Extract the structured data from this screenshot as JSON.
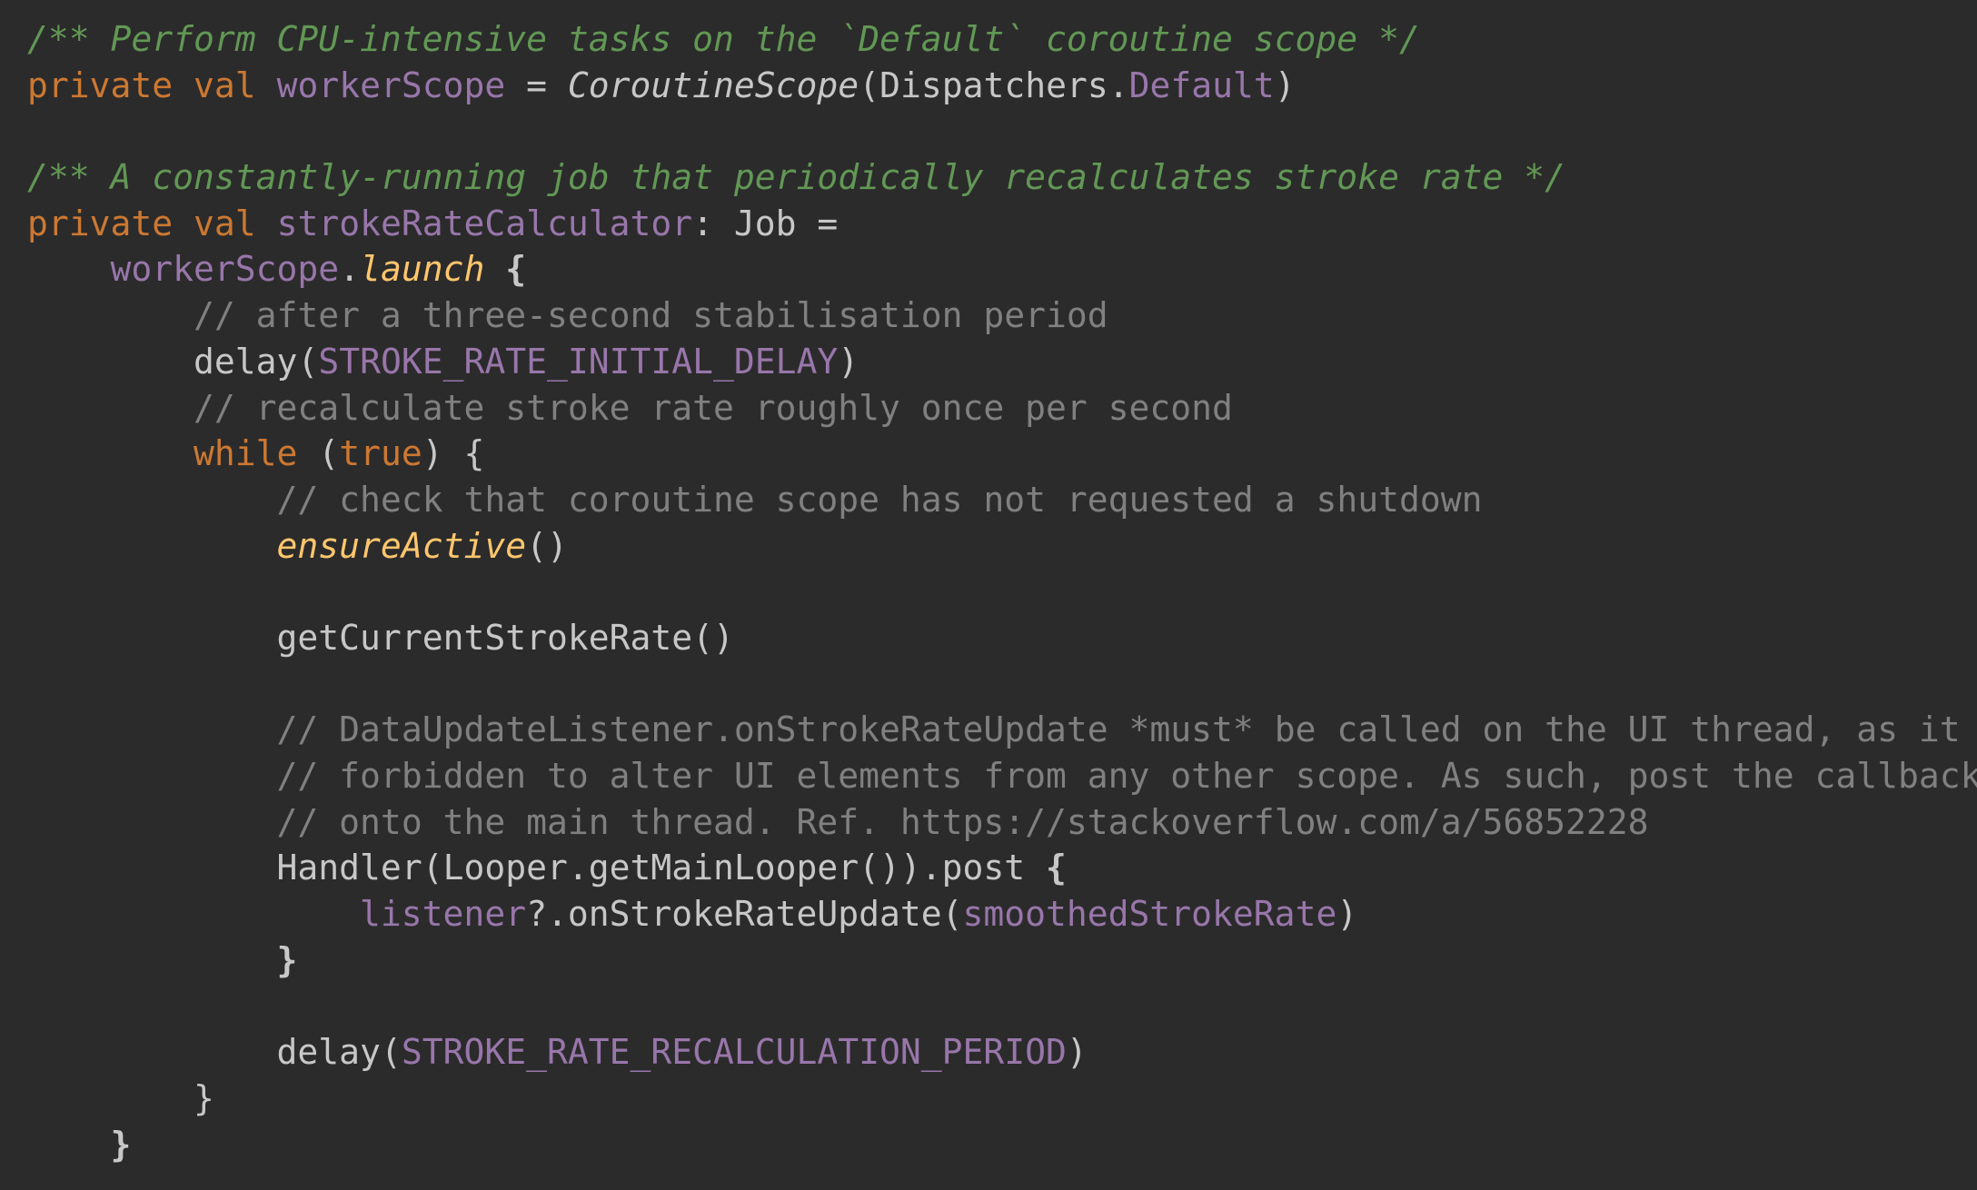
{
  "theme": {
    "background": "#2b2b2b",
    "default_text": "#c7c7c7",
    "keyword": "#cc7832",
    "property": "#9876aa",
    "doc_comment": "#629755",
    "line_comment": "#808080",
    "extension_call": "#ffc66d"
  },
  "code": {
    "l1": {
      "doc": "/** Perform CPU-intensive tasks on the `Default` coroutine scope */"
    },
    "l2": {
      "kw_private": "private",
      "kw_val": "val",
      "name": "workerScope",
      "eq": " = ",
      "ctor": "CoroutineScope",
      "open": "(",
      "dispatchers": "Dispatchers.",
      "default": "Default",
      "close": ")"
    },
    "l4": {
      "doc": "/** A constantly-running job that periodically recalculates stroke rate */"
    },
    "l5": {
      "kw_private": "private",
      "kw_val": "val",
      "name": "strokeRateCalculator",
      "type": ": Job ="
    },
    "l6": {
      "recv": "workerScope",
      "dot": ".",
      "launch": "launch",
      "brace": " {"
    },
    "l7": {
      "comment": "// after a three-second stabilisation period"
    },
    "l8": {
      "fn": "delay",
      "open": "(",
      "arg": "STROKE_RATE_INITIAL_DELAY",
      "close": ")"
    },
    "l9": {
      "comment": "// recalculate stroke rate roughly once per second"
    },
    "l10": {
      "kw_while": "while",
      "open": " (",
      "kw_true": "true",
      "close": ") {"
    },
    "l11": {
      "comment": "// check that coroutine scope has not requested a shutdown"
    },
    "l12": {
      "fn": "ensureActive",
      "parens": "()"
    },
    "l14": {
      "text": "getCurrentStrokeRate()"
    },
    "l16": {
      "comment": "// DataUpdateListener.onStrokeRateUpdate *must* be called on the UI thread, as it is"
    },
    "l17": {
      "comment": "// forbidden to alter UI elements from any other scope. As such, post the callback"
    },
    "l18": {
      "comment": "// onto the main thread. Ref. https://stackoverflow.com/a/56852228"
    },
    "l19": {
      "text": "Handler(Looper.getMainLooper()).post",
      "brace": " {"
    },
    "l20": {
      "listener": "listener",
      "call": "?.onStrokeRateUpdate(",
      "arg": "smoothedStrokeRate",
      "close": ")"
    },
    "l21": {
      "brace": "}"
    },
    "l23": {
      "fn": "delay",
      "open": "(",
      "arg": "STROKE_RATE_RECALCULATION_PERIOD",
      "close": ")"
    },
    "l24": {
      "brace": "}"
    },
    "l25": {
      "brace": "}"
    }
  }
}
